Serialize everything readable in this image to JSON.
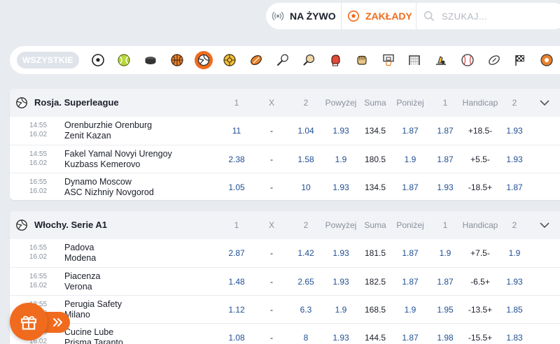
{
  "topbar": {
    "live_label": "NA ŻYWO",
    "bets_label": "ZAKŁADY",
    "search_placeholder": "SZUKAJ..."
  },
  "sportsbar": {
    "all_label": "WSZYSTKIE",
    "icons": [
      "football-icon",
      "tennis-icon",
      "hockey-icon",
      "basketball-icon",
      "volleyball-icon",
      "handball-icon",
      "rugby-icon",
      "badminton-icon",
      "table-tennis-icon",
      "boxing-icon",
      "mma-icon",
      "basketball-hoop-icon",
      "futsal-goal-icon",
      "motorsport-icon",
      "baseball-icon",
      "american-football-icon",
      "racing-flag-icon",
      "beach-ball-icon"
    ],
    "active": "volleyball-icon"
  },
  "colors": {
    "accent": "#f06b1d",
    "odds": "#1f4f93"
  },
  "leagues": [
    {
      "title": "Rosja. Superleague",
      "headers": [
        "1",
        "X",
        "2",
        "Powyżej",
        "Suma",
        "Poniżej",
        "1",
        "Handicap",
        "2"
      ],
      "rows": [
        {
          "time": "14:55",
          "date": "16.02",
          "home": "Orenburzhie Orenburg",
          "away": "Zenit Kazan",
          "o1": "11",
          "ox": "-",
          "o2": "1.04",
          "over": "1.93",
          "total": "134.5",
          "under": "1.87",
          "h1": "1.87",
          "hcp": "+18.5-",
          "h2": "1.93"
        },
        {
          "time": "14:55",
          "date": "16.02",
          "home": "Fakel Yamal Novyi Urengoy",
          "away": "Kuzbass Kemerovo",
          "o1": "2.38",
          "ox": "-",
          "o2": "1.58",
          "over": "1.9",
          "total": "180.5",
          "under": "1.9",
          "h1": "1.87",
          "hcp": "+5.5-",
          "h2": "1.93"
        },
        {
          "time": "16:55",
          "date": "16.02",
          "home": "Dynamo Moscow",
          "away": "ASC Nizhniy Novgorod",
          "o1": "1.05",
          "ox": "-",
          "o2": "10",
          "over": "1.93",
          "total": "134.5",
          "under": "1.87",
          "h1": "1.93",
          "hcp": "-18.5+",
          "h2": "1.87"
        }
      ]
    },
    {
      "title": "Włochy. Serie A1",
      "headers": [
        "1",
        "X",
        "2",
        "Powyżej",
        "Suma",
        "Poniżej",
        "1",
        "Handicap",
        "2"
      ],
      "rows": [
        {
          "time": "16:55",
          "date": "16.02",
          "home": "Padova",
          "away": "Modena",
          "o1": "2.87",
          "ox": "-",
          "o2": "1.42",
          "over": "1.93",
          "total": "181.5",
          "under": "1.87",
          "h1": "1.9",
          "hcp": "+7.5-",
          "h2": "1.9"
        },
        {
          "time": "16:55",
          "date": "16.02",
          "home": "Piacenza",
          "away": "Verona",
          "o1": "1.48",
          "ox": "-",
          "o2": "2.65",
          "over": "1.93",
          "total": "182.5",
          "under": "1.87",
          "h1": "1.87",
          "hcp": "-6.5+",
          "h2": "1.93"
        },
        {
          "time": "18:55",
          "date": "16.02",
          "home": "Perugia Safety",
          "away": "Milano",
          "o1": "1.12",
          "ox": "-",
          "o2": "6.3",
          "over": "1.9",
          "total": "168.5",
          "under": "1.9",
          "h1": "1.95",
          "hcp": "-13.5+",
          "h2": "1.85"
        },
        {
          "time": "18:55",
          "date": "16.02",
          "home": "Cucine Lube",
          "away": "Prisma Taranto",
          "o1": "1.08",
          "ox": "-",
          "o2": "8",
          "over": "1.93",
          "total": "144.5",
          "under": "1.87",
          "h1": "1.98",
          "hcp": "-15.5+",
          "h2": "1.83"
        }
      ]
    }
  ]
}
